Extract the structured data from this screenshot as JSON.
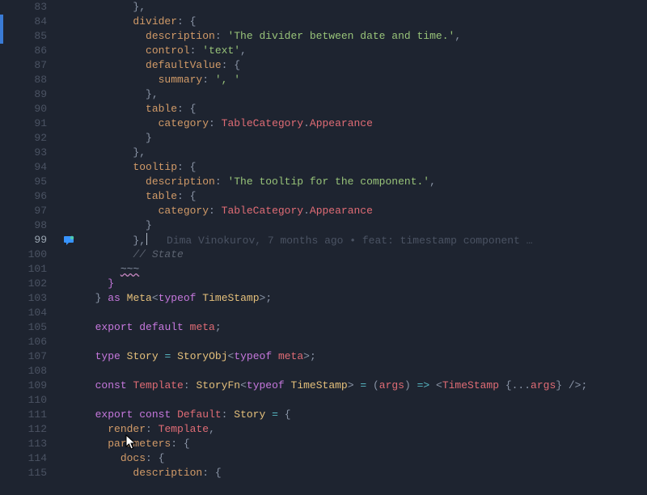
{
  "blame": {
    "author": "Dima Vinokurov",
    "when": "7 months ago",
    "message": "feat: timestamp component …"
  },
  "lines": [
    {
      "n": 83,
      "indent": 8,
      "tokens": [
        {
          "t": "}",
          "c": "c-punc"
        },
        {
          "t": ",",
          "c": "c-punc"
        }
      ]
    },
    {
      "n": 84,
      "indent": 8,
      "tokens": [
        {
          "t": "divider",
          "c": "c-key"
        },
        {
          "t": ": {",
          "c": "c-punc"
        }
      ]
    },
    {
      "n": 85,
      "indent": 10,
      "tokens": [
        {
          "t": "description",
          "c": "c-key"
        },
        {
          "t": ": ",
          "c": "c-punc"
        },
        {
          "t": "'The divider between date and time.'",
          "c": "c-str"
        },
        {
          "t": ",",
          "c": "c-punc"
        }
      ]
    },
    {
      "n": 86,
      "indent": 10,
      "tokens": [
        {
          "t": "control",
          "c": "c-key"
        },
        {
          "t": ": ",
          "c": "c-punc"
        },
        {
          "t": "'text'",
          "c": "c-str"
        },
        {
          "t": ",",
          "c": "c-punc"
        }
      ]
    },
    {
      "n": 87,
      "indent": 10,
      "tokens": [
        {
          "t": "defaultValue",
          "c": "c-key"
        },
        {
          "t": ": {",
          "c": "c-punc"
        }
      ]
    },
    {
      "n": 88,
      "indent": 12,
      "tokens": [
        {
          "t": "summary",
          "c": "c-key"
        },
        {
          "t": ": ",
          "c": "c-punc"
        },
        {
          "t": "', '",
          "c": "c-str"
        }
      ]
    },
    {
      "n": 89,
      "indent": 10,
      "tokens": [
        {
          "t": "},",
          "c": "c-punc"
        }
      ]
    },
    {
      "n": 90,
      "indent": 10,
      "tokens": [
        {
          "t": "table",
          "c": "c-key"
        },
        {
          "t": ": {",
          "c": "c-punc"
        }
      ]
    },
    {
      "n": 91,
      "indent": 12,
      "tokens": [
        {
          "t": "category",
          "c": "c-key"
        },
        {
          "t": ": ",
          "c": "c-punc"
        },
        {
          "t": "TableCategory",
          "c": "c-ident"
        },
        {
          "t": ".",
          "c": "c-punc"
        },
        {
          "t": "Appearance",
          "c": "c-ident"
        }
      ]
    },
    {
      "n": 92,
      "indent": 10,
      "tokens": [
        {
          "t": "}",
          "c": "c-punc"
        }
      ]
    },
    {
      "n": 93,
      "indent": 8,
      "tokens": [
        {
          "t": "},",
          "c": "c-punc"
        }
      ]
    },
    {
      "n": 94,
      "indent": 8,
      "tokens": [
        {
          "t": "tooltip",
          "c": "c-key"
        },
        {
          "t": ": {",
          "c": "c-punc"
        }
      ]
    },
    {
      "n": 95,
      "indent": 10,
      "tokens": [
        {
          "t": "description",
          "c": "c-key"
        },
        {
          "t": ": ",
          "c": "c-punc"
        },
        {
          "t": "'The tooltip for the component.'",
          "c": "c-str"
        },
        {
          "t": ",",
          "c": "c-punc"
        }
      ]
    },
    {
      "n": 96,
      "indent": 10,
      "tokens": [
        {
          "t": "table",
          "c": "c-key"
        },
        {
          "t": ": {",
          "c": "c-punc"
        }
      ]
    },
    {
      "n": 97,
      "indent": 12,
      "tokens": [
        {
          "t": "category",
          "c": "c-key"
        },
        {
          "t": ": ",
          "c": "c-punc"
        },
        {
          "t": "TableCategory",
          "c": "c-ident"
        },
        {
          "t": ".",
          "c": "c-punc"
        },
        {
          "t": "Appearance",
          "c": "c-ident"
        }
      ]
    },
    {
      "n": 98,
      "indent": 10,
      "tokens": [
        {
          "t": "}",
          "c": "c-punc"
        }
      ]
    },
    {
      "n": 99,
      "indent": 8,
      "active": true,
      "chat": true,
      "blame": true,
      "tokens": [
        {
          "t": "},",
          "c": "c-punc"
        }
      ],
      "caret": true
    },
    {
      "n": 100,
      "indent": 8,
      "tokens": [
        {
          "t": "// State",
          "c": "c-comment"
        }
      ]
    },
    {
      "n": 101,
      "indent": 6,
      "tokens": [
        {
          "t": "~~~",
          "c": "c-punc squiggle"
        }
      ]
    },
    {
      "n": 102,
      "indent": 4,
      "tokens": [
        {
          "t": "}",
          "c": "c-kw"
        }
      ]
    },
    {
      "n": 103,
      "indent": 2,
      "tokens": [
        {
          "t": "} ",
          "c": "c-punc"
        },
        {
          "t": "as",
          "c": "c-kw"
        },
        {
          "t": " ",
          "c": "c-plain"
        },
        {
          "t": "Meta",
          "c": "c-type"
        },
        {
          "t": "<",
          "c": "c-angle"
        },
        {
          "t": "typeof",
          "c": "c-kw"
        },
        {
          "t": " ",
          "c": "c-plain"
        },
        {
          "t": "TimeStamp",
          "c": "c-type"
        },
        {
          "t": ">;",
          "c": "c-punc"
        }
      ]
    },
    {
      "n": 104,
      "indent": 0,
      "tokens": []
    },
    {
      "n": 105,
      "indent": 2,
      "tokens": [
        {
          "t": "export",
          "c": "c-kw"
        },
        {
          "t": " ",
          "c": "c-plain"
        },
        {
          "t": "default",
          "c": "c-kw"
        },
        {
          "t": " ",
          "c": "c-plain"
        },
        {
          "t": "meta",
          "c": "c-var"
        },
        {
          "t": ";",
          "c": "c-punc"
        }
      ]
    },
    {
      "n": 106,
      "indent": 0,
      "tokens": []
    },
    {
      "n": 107,
      "indent": 2,
      "tokens": [
        {
          "t": "type",
          "c": "c-kw"
        },
        {
          "t": " ",
          "c": "c-plain"
        },
        {
          "t": "Story",
          "c": "c-type"
        },
        {
          "t": " ",
          "c": "c-plain"
        },
        {
          "t": "=",
          "c": "c-op"
        },
        {
          "t": " ",
          "c": "c-plain"
        },
        {
          "t": "StoryObj",
          "c": "c-type"
        },
        {
          "t": "<",
          "c": "c-angle"
        },
        {
          "t": "typeof",
          "c": "c-kw"
        },
        {
          "t": " ",
          "c": "c-plain"
        },
        {
          "t": "meta",
          "c": "c-var"
        },
        {
          "t": ">;",
          "c": "c-punc"
        }
      ]
    },
    {
      "n": 108,
      "indent": 0,
      "tokens": []
    },
    {
      "n": 109,
      "indent": 2,
      "tokens": [
        {
          "t": "const",
          "c": "c-kw"
        },
        {
          "t": " ",
          "c": "c-plain"
        },
        {
          "t": "Template",
          "c": "c-var"
        },
        {
          "t": ": ",
          "c": "c-punc"
        },
        {
          "t": "StoryFn",
          "c": "c-type"
        },
        {
          "t": "<",
          "c": "c-angle"
        },
        {
          "t": "typeof",
          "c": "c-kw"
        },
        {
          "t": " ",
          "c": "c-plain"
        },
        {
          "t": "TimeStamp",
          "c": "c-type"
        },
        {
          "t": "> ",
          "c": "c-angle"
        },
        {
          "t": "=",
          "c": "c-op"
        },
        {
          "t": " (",
          "c": "c-punc"
        },
        {
          "t": "args",
          "c": "c-var"
        },
        {
          "t": ") ",
          "c": "c-punc"
        },
        {
          "t": "=>",
          "c": "c-op"
        },
        {
          "t": " <",
          "c": "c-angle"
        },
        {
          "t": "TimeStamp",
          "c": "c-tag"
        },
        {
          "t": " {...",
          "c": "c-punc"
        },
        {
          "t": "args",
          "c": "c-var"
        },
        {
          "t": "} />;",
          "c": "c-punc"
        }
      ]
    },
    {
      "n": 110,
      "indent": 0,
      "tokens": []
    },
    {
      "n": 111,
      "indent": 2,
      "tokens": [
        {
          "t": "export",
          "c": "c-kw"
        },
        {
          "t": " ",
          "c": "c-plain"
        },
        {
          "t": "const",
          "c": "c-kw"
        },
        {
          "t": " ",
          "c": "c-plain"
        },
        {
          "t": "Default",
          "c": "c-var"
        },
        {
          "t": ": ",
          "c": "c-punc"
        },
        {
          "t": "Story",
          "c": "c-type"
        },
        {
          "t": " ",
          "c": "c-plain"
        },
        {
          "t": "=",
          "c": "c-op"
        },
        {
          "t": " {",
          "c": "c-punc"
        }
      ]
    },
    {
      "n": 112,
      "indent": 4,
      "tokens": [
        {
          "t": "render",
          "c": "c-key"
        },
        {
          "t": ": ",
          "c": "c-punc"
        },
        {
          "t": "Template",
          "c": "c-var"
        },
        {
          "t": ",",
          "c": "c-punc"
        }
      ]
    },
    {
      "n": 113,
      "indent": 4,
      "tokens": [
        {
          "t": "parameters",
          "c": "c-key"
        },
        {
          "t": ": {",
          "c": "c-punc"
        }
      ]
    },
    {
      "n": 114,
      "indent": 6,
      "tokens": [
        {
          "t": "docs",
          "c": "c-key"
        },
        {
          "t": ": {",
          "c": "c-punc"
        }
      ]
    },
    {
      "n": 115,
      "indent": 8,
      "tokens": [
        {
          "t": "description",
          "c": "c-key"
        },
        {
          "t": ": {",
          "c": "c-punc"
        }
      ]
    }
  ]
}
